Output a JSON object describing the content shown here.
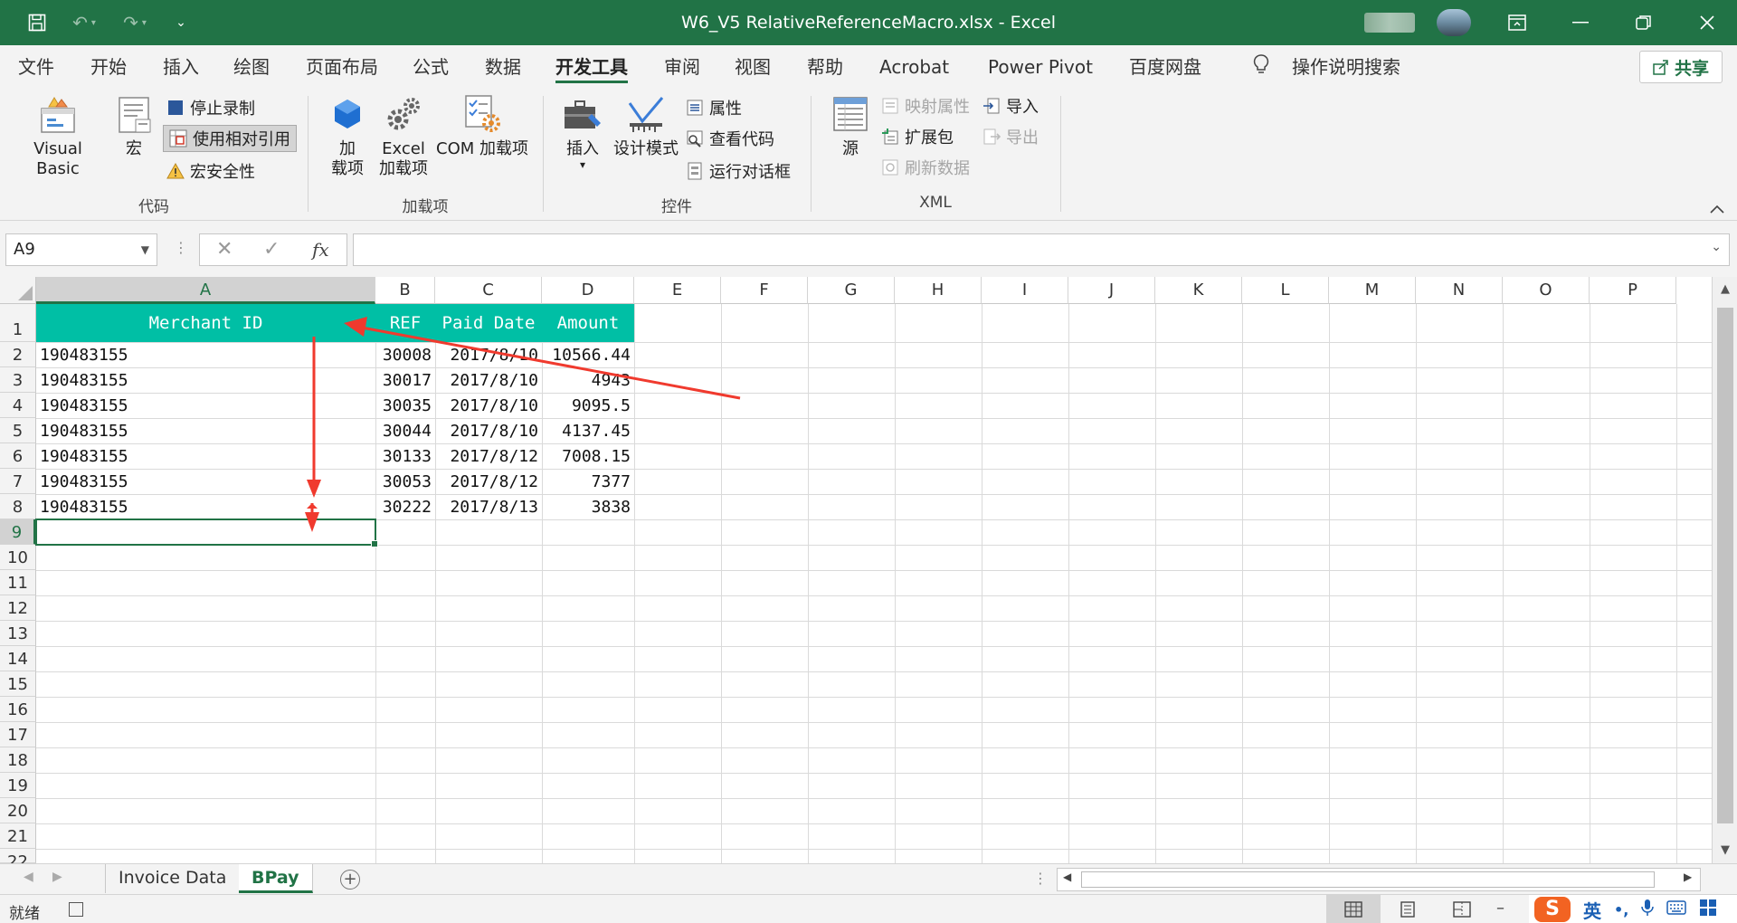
{
  "window": {
    "title": "W6_V5 RelativeReferenceMacro.xlsx  -  Excel"
  },
  "menu": {
    "tabs": [
      "文件",
      "开始",
      "插入",
      "绘图",
      "页面布局",
      "公式",
      "数据",
      "开发工具",
      "审阅",
      "视图",
      "帮助",
      "Acrobat",
      "Power Pivot",
      "百度网盘"
    ],
    "active_tab": "开发工具",
    "search_label": "操作说明搜索",
    "share_label": "共享"
  },
  "ribbon": {
    "code": {
      "label": "代码",
      "visual_basic": "Visual Basic",
      "macros": "宏",
      "stop_recording": "停止录制",
      "use_relative": "使用相对引用",
      "macro_security": "宏安全性"
    },
    "addins": {
      "label": "加载项",
      "addins_line1": "加",
      "addins_line2": "载项",
      "excel_addins_line1": "Excel",
      "excel_addins_line2": "加载项",
      "com_addins": "COM 加载项"
    },
    "controls": {
      "label": "控件",
      "insert": "插入",
      "design_mode": "设计模式",
      "properties": "属性",
      "view_code": "查看代码",
      "run_dialog": "运行对话框"
    },
    "xml": {
      "label": "XML",
      "source": "源",
      "map_properties": "映射属性",
      "expansion_packs": "扩展包",
      "refresh_data": "刷新数据",
      "import": "导入",
      "export": "导出"
    }
  },
  "formula_bar": {
    "name_box": "A9",
    "formula": "",
    "fx": "fx"
  },
  "columns": [
    "A",
    "B",
    "C",
    "D",
    "E",
    "F",
    "G",
    "H",
    "I",
    "J",
    "K",
    "L",
    "M",
    "N",
    "O",
    "P"
  ],
  "rows": [
    "1",
    "2",
    "3",
    "4",
    "5",
    "6",
    "7",
    "8",
    "9",
    "10",
    "11",
    "12",
    "13",
    "14",
    "15",
    "16",
    "17",
    "18",
    "19",
    "20",
    "21",
    "22"
  ],
  "table": {
    "headers": [
      "Merchant ID",
      "REF",
      "Paid Date",
      "Amount"
    ],
    "rows": [
      [
        "190483155",
        "30008",
        "2017/8/10",
        "10566.44"
      ],
      [
        "190483155",
        "30017",
        "2017/8/10",
        "4943"
      ],
      [
        "190483155",
        "30035",
        "2017/8/10",
        "9095.5"
      ],
      [
        "190483155",
        "30044",
        "2017/8/10",
        "4137.45"
      ],
      [
        "190483155",
        "30133",
        "2017/8/12",
        "7008.15"
      ],
      [
        "190483155",
        "30053",
        "2017/8/12",
        "7377"
      ],
      [
        "190483155",
        "30222",
        "2017/8/13",
        "3838"
      ]
    ],
    "header_color": "#00BFA5"
  },
  "sheets": {
    "tabs": [
      "Invoice Data",
      "BPay"
    ],
    "active": "BPay"
  },
  "status": {
    "text": "就绪"
  },
  "ime": {
    "mode": "英",
    "punct": "•,"
  },
  "colors": {
    "excel_green": "#217346",
    "annotation_red": "#F03A2E"
  }
}
